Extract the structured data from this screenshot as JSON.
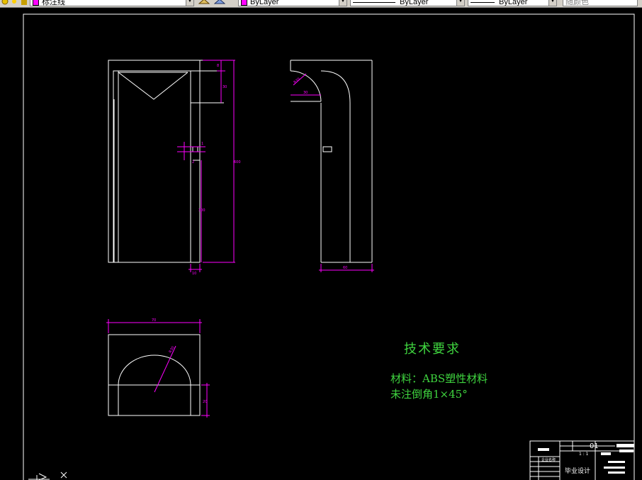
{
  "toolbar": {
    "layer_name": "标注线",
    "color": "ByLayer",
    "linetype": "ByLayer",
    "lineweight": "ByLayer",
    "plotstyle": "随颜色"
  },
  "drawing": {
    "front_view_dims": [
      "8",
      "30",
      "600",
      "300",
      "10",
      "1",
      "2"
    ],
    "side_view_dims": [
      "R30",
      "30",
      "60"
    ],
    "bottom_view_dims": [
      "70",
      "R30",
      "20"
    ]
  },
  "notes": {
    "heading": "技术要求",
    "line1": "材料：ABS塑性材料",
    "line2": "未注倒角1×45°"
  },
  "title_block": {
    "drawing_no": "01",
    "scale": "1 : 1",
    "title": "毕业设计",
    "school_code": "企业名称"
  },
  "colors": {
    "background": "#000000",
    "geometry": "#ffffff",
    "dimension": "#ff00ff",
    "notes_text": "#3fd43f"
  }
}
